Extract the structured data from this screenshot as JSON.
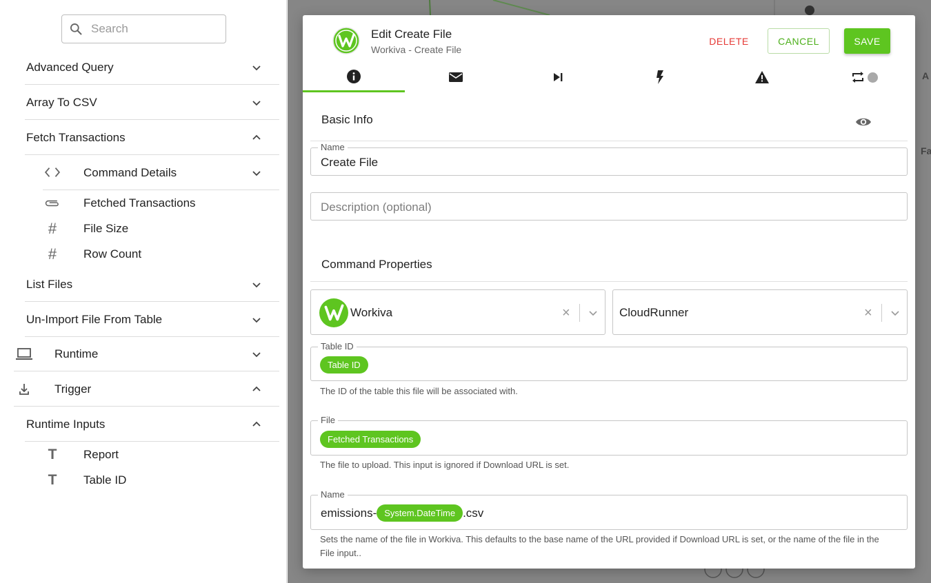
{
  "sidebar": {
    "search_placeholder": "Search",
    "items": [
      {
        "label": "Advanced Query"
      },
      {
        "label": "Array To CSV"
      },
      {
        "label": "Fetch Transactions"
      },
      {
        "label": "Command Details"
      },
      {
        "label": "Fetched Transactions"
      },
      {
        "label": "File Size"
      },
      {
        "label": "Row Count"
      },
      {
        "label": "List Files"
      },
      {
        "label": "Un-Import File From Table"
      },
      {
        "label": "Runtime"
      },
      {
        "label": "Trigger"
      },
      {
        "label": "Runtime Inputs"
      },
      {
        "label": "Report"
      },
      {
        "label": "Table ID"
      }
    ],
    "icons": {
      "command_details": "code-icon",
      "fetched_transactions": "paperclip-icon",
      "number": "hash-icon",
      "text": "text-icon",
      "runtime": "laptop-icon",
      "trigger": "download-icon"
    }
  },
  "canvas": {
    "edge_text_1": "A",
    "edge_text_2": "Fa"
  },
  "modal": {
    "title": "Edit Create File",
    "subtitle": "Workiva - Create File",
    "buttons": {
      "delete": "DELETE",
      "cancel": "CANCEL",
      "save": "SAVE"
    },
    "tabs": [
      {
        "icon": "info-icon",
        "active": true
      },
      {
        "icon": "mail-icon"
      },
      {
        "icon": "skip-next-icon"
      },
      {
        "icon": "bolt-icon"
      },
      {
        "icon": "warning-icon"
      },
      {
        "icon": "repeat-icon"
      }
    ],
    "basic_info": {
      "title": "Basic Info",
      "name_legend": "Name",
      "name_value": "Create File",
      "description_placeholder": "Description (optional)"
    },
    "command_properties": {
      "title": "Command Properties",
      "connector": "Workiva",
      "runner": "CloudRunner",
      "table_id": {
        "legend": "Table ID",
        "chip": "Table ID",
        "helper": "The ID of the table this file will be associated with."
      },
      "file": {
        "legend": "File",
        "chip": "Fetched Transactions",
        "helper": "The file to upload. This input is ignored if Download URL is set."
      },
      "filename": {
        "legend": "Name",
        "prefix": "emissions-",
        "chip": "System.DateTime",
        "suffix": ".csv",
        "helper": "Sets the name of the file in Workiva. This defaults to the base name of the URL provided if Download URL is set, or the name of the file in the File input.."
      }
    },
    "colors": {
      "accent": "#5ec520",
      "danger": "#e53935"
    }
  }
}
